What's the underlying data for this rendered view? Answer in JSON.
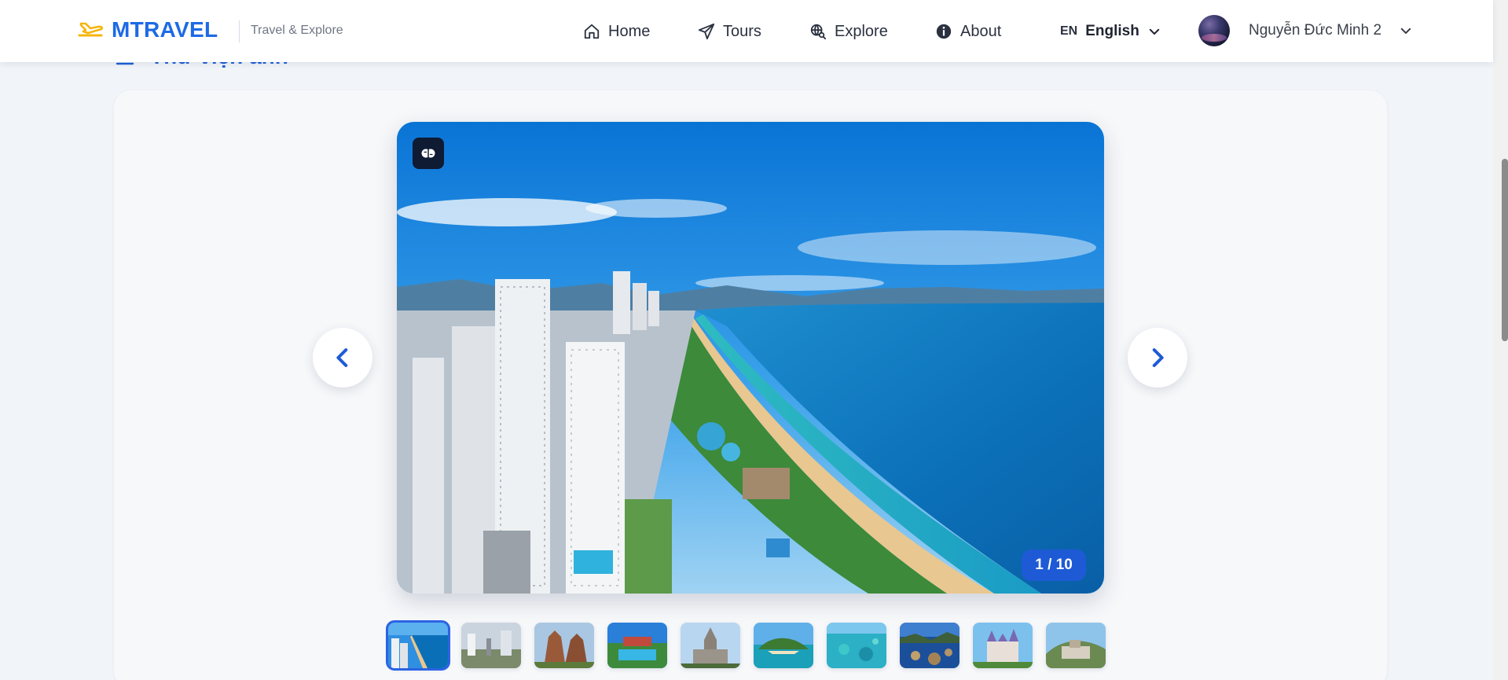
{
  "header": {
    "logo_text": "MTRAVEL",
    "tagline": "Travel & Explore",
    "nav": [
      {
        "label": "Home",
        "icon": "home-icon"
      },
      {
        "label": "Tours",
        "icon": "paper-plane-icon"
      },
      {
        "label": "Explore",
        "icon": "globe-search-icon"
      },
      {
        "label": "About",
        "icon": "info-icon"
      }
    ],
    "language": {
      "code": "EN",
      "name": "English"
    },
    "user": {
      "name": "Nguyễn Đức Minh 2"
    }
  },
  "section": {
    "title": "Thư viện ảnh",
    "icon": "gallery-icon"
  },
  "gallery": {
    "current": 1,
    "total": 10,
    "counter_text": "1 / 10",
    "badge_icon": "ai-brain-icon",
    "thumbnails": [
      {
        "subject": "city-beach",
        "active": true
      },
      {
        "subject": "monument-plaza",
        "active": false
      },
      {
        "subject": "cham-towers",
        "active": false
      },
      {
        "subject": "resort-pool",
        "active": false
      },
      {
        "subject": "stone-church",
        "active": false
      },
      {
        "subject": "green-island",
        "active": false
      },
      {
        "subject": "coral-sea",
        "active": false
      },
      {
        "subject": "rocky-coast",
        "active": false
      },
      {
        "subject": "castle-park",
        "active": false
      },
      {
        "subject": "hill-resort",
        "active": false
      }
    ]
  },
  "colors": {
    "brand": "#1d6ae5",
    "accent": "#1e5ad6",
    "logo_plane": "#f5b50a"
  }
}
